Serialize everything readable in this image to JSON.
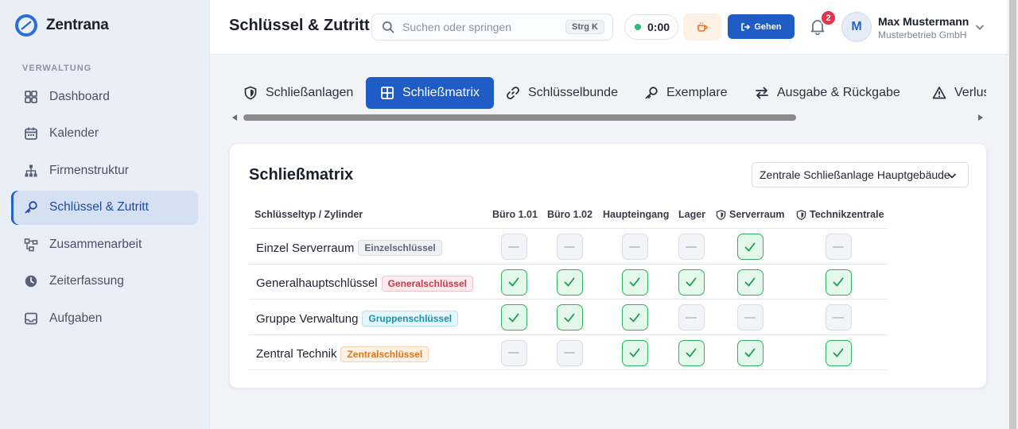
{
  "app": {
    "name": "Zentrana"
  },
  "sidebar": {
    "section_label": "VERWALTUNG",
    "items": [
      {
        "label": "Dashboard",
        "icon": "grid-icon"
      },
      {
        "label": "Kalender",
        "icon": "calendar-icon"
      },
      {
        "label": "Firmenstruktur",
        "icon": "org-chart-icon"
      },
      {
        "label": "Schlüssel & Zutritt",
        "icon": "key-icon",
        "active": true
      },
      {
        "label": "Zusammenarbeit",
        "icon": "collaboration-icon"
      },
      {
        "label": "Zeiterfassung",
        "icon": "clock-icon"
      },
      {
        "label": "Aufgaben",
        "icon": "inbox-icon"
      }
    ]
  },
  "header": {
    "title": "Schlüssel & Zutritt",
    "search": {
      "placeholder": "Suchen oder springen",
      "shortcut": "Strg K"
    },
    "timer": "0:00",
    "go_label": "Gehen",
    "notifications": "2",
    "user": {
      "initial": "M",
      "name": "Max Mustermann",
      "org": "Musterbetrieb GmbH"
    }
  },
  "tabs": [
    {
      "label": "Schließanlagen",
      "icon": "shield-icon"
    },
    {
      "label": "Schließmatrix",
      "icon": "table-icon",
      "active": true
    },
    {
      "label": "Schlüsselbunde",
      "icon": "link-icon"
    },
    {
      "label": "Exemplare",
      "icon": "key-icon"
    },
    {
      "label": "Ausgabe & Rückgabe",
      "icon": "swap-icon"
    },
    {
      "label": "Verlust",
      "icon": "warning-icon"
    }
  ],
  "matrix": {
    "title": "Schließmatrix",
    "selected_system": "Zentrale Schließanlage Hauptgebäude",
    "header_label": "Schlüsseltyp / Zylinder",
    "columns": [
      "Büro 1.01",
      "Büro 1.02",
      "Haupteingang",
      "Lager",
      "Serverraum",
      "Technikzentrale"
    ],
    "secured_columns": [
      "Serverraum",
      "Technikzentrale"
    ],
    "rows": [
      {
        "name": "Einzel Serverraum",
        "tag": "Einzelschlüssel",
        "tag_color": "#5f6676",
        "access": [
          false,
          false,
          false,
          false,
          true,
          false
        ]
      },
      {
        "name": "Generalhauptschlüssel",
        "tag": "Generalschlüssel",
        "tag_color": "#d13447",
        "access": [
          true,
          true,
          true,
          true,
          true,
          true
        ]
      },
      {
        "name": "Gruppe Verwaltung",
        "tag": "Gruppenschlüssel",
        "tag_color": "#1593b0",
        "access": [
          true,
          true,
          true,
          false,
          false,
          false
        ]
      },
      {
        "name": "Zentral Technik",
        "tag": "Zentralschlüssel",
        "tag_color": "#e0761c",
        "access": [
          false,
          false,
          true,
          true,
          true,
          true
        ]
      }
    ]
  }
}
